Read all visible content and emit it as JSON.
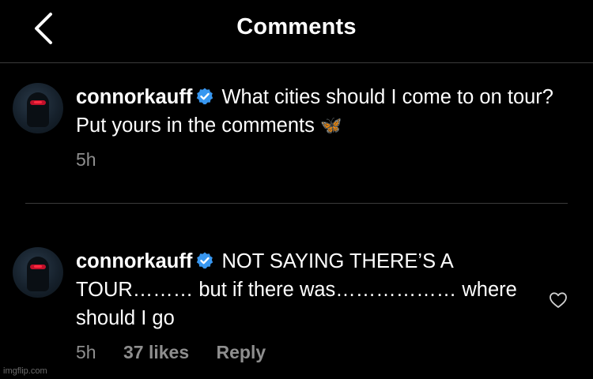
{
  "header": {
    "title": "Comments",
    "back_icon": "chevron-left-icon"
  },
  "caption": {
    "username": "connorkauff",
    "verified_icon": "verified-badge-icon",
    "text": "What cities should I come to on tour? Put yours in the comments",
    "emoji": "🦋",
    "time": "5h"
  },
  "comment": {
    "username": "connorkauff",
    "verified_icon": "verified-badge-icon",
    "text": "NOT SAYING THERE’S A TOUR……… but if there was……………… where should I go",
    "time": "5h",
    "likes": "37 likes",
    "reply": "Reply",
    "like_icon": "heart-outline-icon"
  },
  "watermark": "imgflip.com",
  "colors": {
    "background": "#000000",
    "text": "#ffffff",
    "meta_text": "#8e8e8e",
    "verified": "#3897f0",
    "divider": "#3a3a3a"
  }
}
